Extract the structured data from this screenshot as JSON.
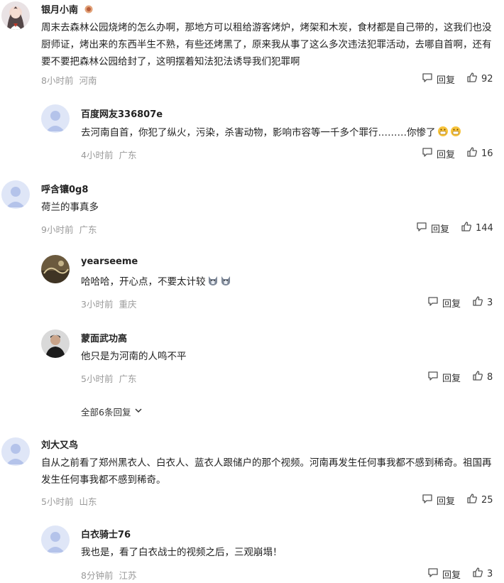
{
  "icons": {
    "reply": "comment-bubble-icon",
    "like": "thumbs-up-icon",
    "expand": "chevron-down-icon",
    "badge": "level-badge-icon"
  },
  "colors": {
    "meta_gray": "#9a9a9a",
    "avatar_default_bg": "#dfe6f7",
    "avatar_default_fg": "#b4c3ea",
    "emoji_yellow": "#f7c33b"
  },
  "reply_label": "回复",
  "comments": [
    {
      "user": "银月小南",
      "text": "周末去森林公园烧烤的怎么办啊，那地方可以租给游客烤炉，烤架和木炭，食材都是自己带的，这我们也没厨师证，烤出来的东西半生不熟，有些还烤黑了，原来我从事了这么多次违法犯罪活动，去哪自首啊，还有要不要把森林公园给封了，这明摆着知法犯法诱导我们犯罪啊",
      "time": "8小时前",
      "location": "河南",
      "likes": "92"
    },
    {
      "user": "百度网友336807e",
      "text": "去河南自首，你犯了纵火，污染，杀害动物，影响市容等一千多个罪行………你惨了",
      "time": "4小时前",
      "location": "广东",
      "likes": "16"
    },
    {
      "user": "呼含镶0g8",
      "text": "荷兰的事真多",
      "time": "9小时前",
      "location": "广东",
      "likes": "144"
    },
    {
      "user": "yearseeme",
      "text": "哈哈哈，开心点，不要太计较",
      "time": "3小时前",
      "location": "重庆",
      "likes": "3"
    },
    {
      "user": "蒙面武功高",
      "text": "他只是为河南的人鸣不平",
      "time": "5小时前",
      "location": "广东",
      "likes": "8"
    },
    {
      "user": "刘大又鸟",
      "text": "自从之前看了郑州黑衣人、白衣人、蓝衣人跟储户的那个视频。河南再发生任何事我都不感到稀奇。祖国再发生任何事我都不感到稀奇。",
      "time": "5小时前",
      "location": "山东",
      "likes": "25"
    },
    {
      "user": "白衣骑士76",
      "text": "我也是，看了白衣战士的视频之后，三观崩塌！",
      "time": "8分钟前",
      "location": "江苏",
      "likes": "3"
    }
  ],
  "show_all_replies": "全部6条回复"
}
